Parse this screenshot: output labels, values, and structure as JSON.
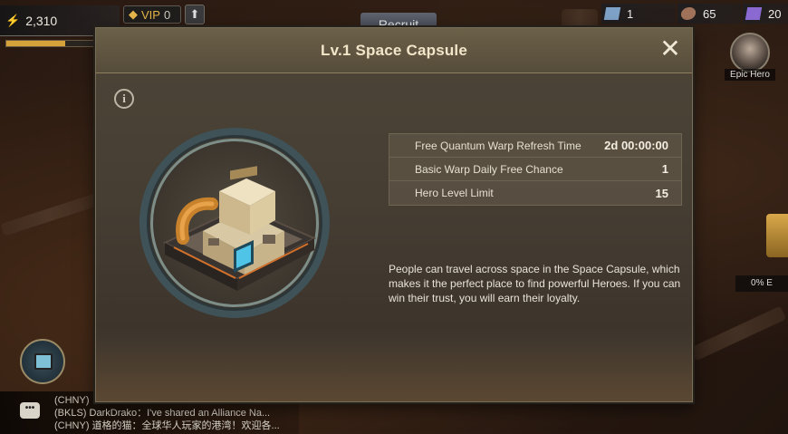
{
  "hud": {
    "power": "2,310",
    "exp_fraction": 0.55,
    "vip_label": "VIP",
    "vip_level": "0",
    "top_button": "Recruit"
  },
  "resources": [
    {
      "icon": "crystal-icon",
      "value": "1",
      "color": "#7fa3c8"
    },
    {
      "icon": "ore-icon",
      "value": "65",
      "color": "#a0735a"
    },
    {
      "icon": "purple-gem-icon",
      "value": "20",
      "color": "#8a6ad0"
    }
  ],
  "epic_hero": {
    "label": "Epic Hero"
  },
  "right_panel": {
    "percent": "0% E"
  },
  "modal": {
    "title": "Lv.1 Space Capsule",
    "close": "✕",
    "info": "i",
    "stats": [
      {
        "label": "Free Quantum Warp Refresh Time",
        "value": "2d 00:00:00"
      },
      {
        "label": "Basic Warp Daily Free Chance",
        "value": "1"
      },
      {
        "label": "Hero Level Limit",
        "value": "15"
      }
    ],
    "description": "People can travel across space in the Space Capsule, which makes it the perfect place to find powerful Heroes. If you can win their trust, you will earn their loyalty."
  },
  "chat": {
    "lines": [
      {
        "channel": "(CHNY)",
        "text": ""
      },
      {
        "channel": "(BKLS)",
        "text": "DarkDrako：I've shared an Alliance Na..."
      },
      {
        "channel": "(CHNY)",
        "text": "道格的猫：全球华人玩家的港湾！欢迎各..."
      }
    ]
  }
}
